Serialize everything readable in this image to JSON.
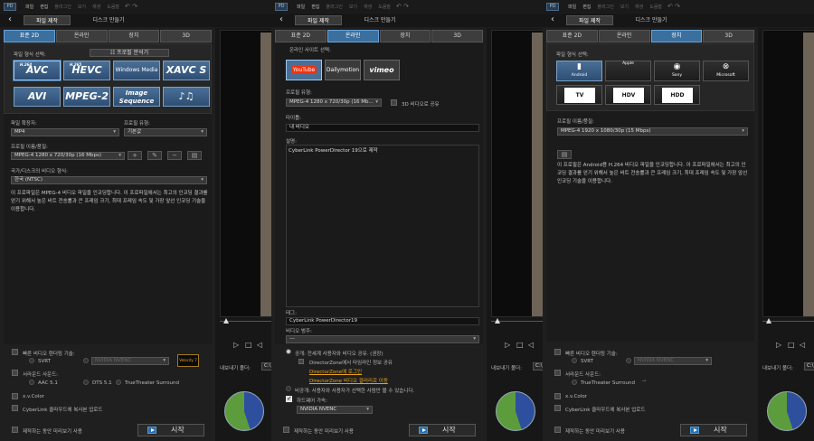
{
  "common": {
    "app_logo": "PD",
    "menu": [
      "파일",
      "편집",
      "플러그인",
      "보기",
      "재생",
      "도움말"
    ],
    "undo_icon": "undo-icon",
    "back_glyph": "‹",
    "mode_tabs": [
      "파일 제작",
      "디스크 만들기"
    ],
    "output_tabs": [
      "표준 2D",
      "온라인",
      "장치",
      "3D"
    ],
    "start_label": "시작",
    "preview_label": "제작하는 동안 미리보기 사용",
    "export_label": "내보내기 폴더:",
    "export_value": "C:\\",
    "preview_controls": [
      "▷",
      "□",
      "◁"
    ],
    "pie_colors": {
      "used": "#2d4f9e",
      "free": "#5c9c3c"
    }
  },
  "panel1": {
    "file_format_label": "파일 형식 선택:",
    "profile_analyzer_label": "프로필 분석기",
    "formats": [
      {
        "sup": "H.264",
        "label": "AVC"
      },
      {
        "sup": "H.265",
        "label": "HEVC"
      },
      {
        "sup": "",
        "label": "Windows Media"
      },
      {
        "sup": "",
        "label": "XAVC S"
      },
      {
        "sup": "",
        "label": "AVI"
      },
      {
        "sup": "",
        "label": "MPEG-2"
      },
      {
        "sup": "",
        "label": "Image Sequence"
      },
      {
        "sup": "",
        "label": "♪♫"
      }
    ],
    "ext_label": "파일 확장자:",
    "ext_value": "MP4",
    "profile_type_label": "프로필 유형:",
    "profile_type_value": "기본값",
    "profile_name_label": "프로필 이름/품질:",
    "profile_name_value": "MPEG-4 1280 x 720/30p (16 Mbps)",
    "profile_buttons": [
      "+",
      "✎",
      "−",
      "▤"
    ],
    "region_label": "국가/디스크의 비디오 형식:",
    "region_value": "한국 (NTSC)",
    "description": "이 프로파일은 MPEG-4 비디오 파일을 인코딩합니다. 이 프로파일에서는 최고의 인코딩 결과를 얻기 위해서 높은 비트 전송률과 큰 프레임 크기, 최대 프레임 속도 및 가장 앞선 인코딩 기술을 이용합니다.",
    "fast_render_label": "빠른 비디오 렌더링 기술:",
    "svrt_label": "SVRT",
    "nvenc_label": "NVIDIA NVENC",
    "velocity_label": "Velocity 7",
    "surround_label": "서라운드 사운드:",
    "aac_label": "AAC 5.1",
    "dts_label": "DTS 5.1",
    "truetheater_label": "TrueTheater Surround",
    "xvcolor_label": "x.v.Color",
    "cyberlink_cloud_label": "CyberLink 클라우드에 복사본 업로드"
  },
  "panel2": {
    "site_label": "온라인 사이트 선택:",
    "sites": [
      "YouTube",
      "Dailymotion",
      "vimeo"
    ],
    "profile_type_label": "프로필 유형:",
    "profile_value": "MPEG-4 1280 x 720/30p (16 Mb...",
    "share3d_label": "3D 비디오로 공유",
    "title_label": "타이틀:",
    "title_value": "내 비디오",
    "desc_label": "설명:",
    "desc_value": "CyberLink PowerDirector 19으로 제작",
    "tags_label": "태그:",
    "tags_value": "CyberLink PowerDirector19",
    "category_label": "비디오 범주:",
    "category_value": "---",
    "public_label": "공개: 전세계 사용자와 비디오 공유. (권장)",
    "dz_label": "DirectorZone에서 타임라인 정보 공유",
    "dz_login": "DirectorZone에 로그인",
    "dz_gallery": "DirectorZone 비디오 갤러리로 이동",
    "private_label": "비공개: 사용자와 사용자가 선택한 사람만 볼 수 있습니다.",
    "hw_label": "하드웨어 가속:",
    "hw_value": "NVIDIA NVENC"
  },
  "panel3": {
    "file_format_label": "파일 형식 선택:",
    "platforms": [
      {
        "icon": "▮",
        "label": "Android"
      },
      {
        "icon": "",
        "label": "Apple"
      },
      {
        "icon": "◉",
        "label": "Sony"
      },
      {
        "icon": "⊗",
        "label": "Microsoft"
      }
    ],
    "discs": [
      "TV",
      "HDV",
      "HDD"
    ],
    "profile_label": "프로필 이름/품질:",
    "profile_value": "MPEG-4 1920 x 1080/30p (15 Mbps)",
    "description": "이 프로필은 Android용 H.264 비디오 파일을 인코딩합니다. 이 프로파일에서는 최고의 인코딩 결과를 얻기 위해서 높은 비트 전송률과 큰 프레임 크기, 최대 프레임 속도 및 가장 앞선 인코딩 기술을 이용합니다.",
    "fast_render_label": "빠른 비디오 렌더링 기술:",
    "svrt_label": "SVRT",
    "nvenc_label": "NVIDIA NVENC",
    "surround_label": "서라운드 사운드:",
    "truetheater_label": "TrueTheater Surround",
    "xvcolor_label": "x.v.Color",
    "cyberlink_cloud_label": "CyberLink 클라우드에 복사본 업로드"
  }
}
